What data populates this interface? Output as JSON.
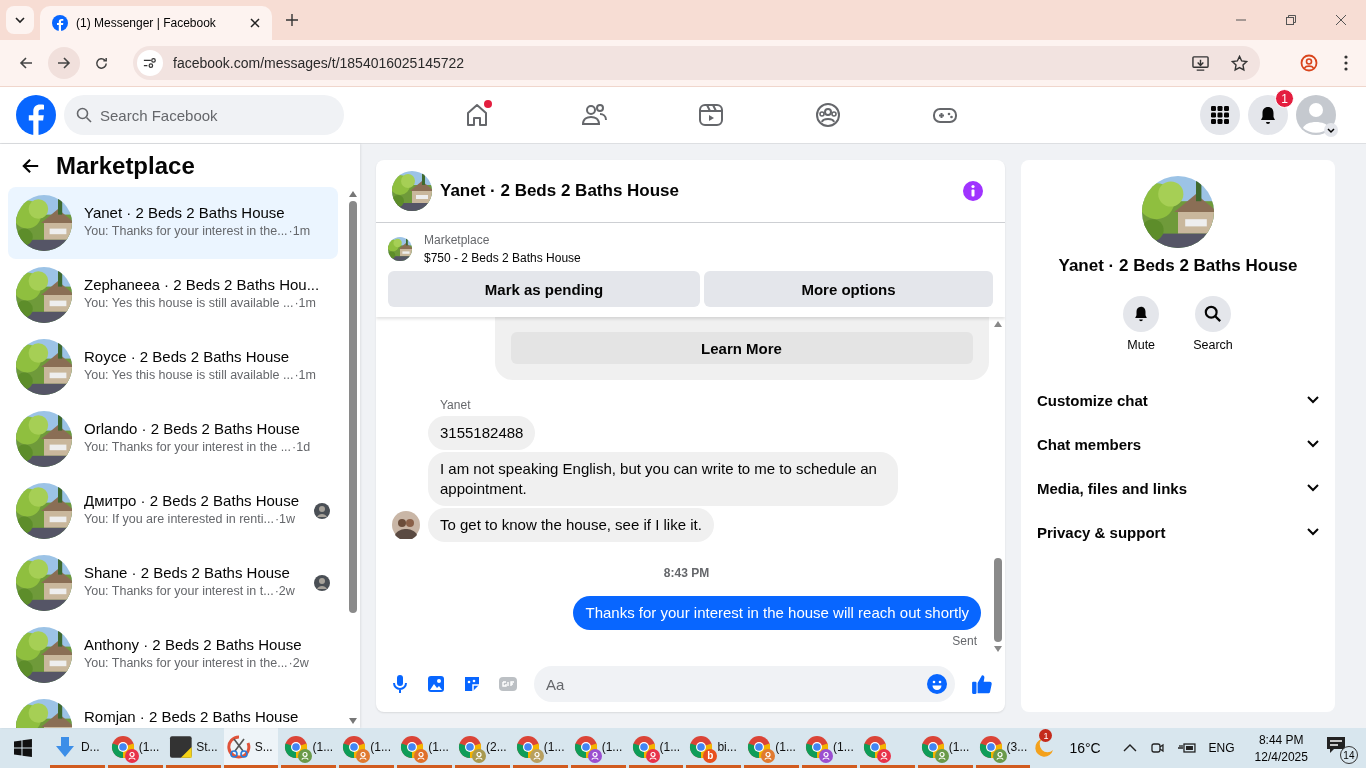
{
  "browser": {
    "tab_title": "(1) Messenger | Facebook",
    "url": "facebook.com/messages/t/1854016025145722"
  },
  "nav": {
    "search_placeholder": "Search Facebook",
    "items": [
      {
        "kind": "home",
        "dot": true
      },
      {
        "kind": "friends",
        "dot": false
      },
      {
        "kind": "video",
        "dot": false
      },
      {
        "kind": "groups",
        "dot": false
      },
      {
        "kind": "gaming",
        "dot": false
      }
    ],
    "notification_count": "1"
  },
  "sidebar": {
    "title": "Marketplace",
    "conversations": [
      {
        "name": "Yanet · 2 Beds 2 Baths House",
        "preview": "You: Thanks for your interest in the...",
        "time": "·1m",
        "selected": true,
        "seen": false
      },
      {
        "name": "Zephaneea · 2 Beds 2 Baths Hou...",
        "preview": "You: Yes this house is still available ...",
        "time": "·1m",
        "selected": false,
        "seen": false
      },
      {
        "name": "Royce · 2 Beds 2 Baths House",
        "preview": "You: Yes this house is still available ...",
        "time": "·1m",
        "selected": false,
        "seen": false
      },
      {
        "name": "Orlando · 2 Beds 2 Baths House",
        "preview": "You: Thanks for your interest in the ...",
        "time": "·1d",
        "selected": false,
        "seen": false
      },
      {
        "name": "Дмитро · 2 Beds 2 Baths House",
        "preview": "You: If you are interested in renti...",
        "time": "·1w",
        "selected": false,
        "seen": true
      },
      {
        "name": "Shane · 2 Beds 2 Baths House",
        "preview": "You: Thanks for your interest in t...",
        "time": "·2w",
        "selected": false,
        "seen": true
      },
      {
        "name": "Anthony · 2 Beds 2 Baths House",
        "preview": "You: Thanks for your interest in the...",
        "time": "·2w",
        "selected": false,
        "seen": false
      },
      {
        "name": "Romjan · 2 Beds 2 Baths House",
        "selected": false,
        "seen": false
      }
    ]
  },
  "chat": {
    "title": "Yanet · 2 Beds 2 Baths House",
    "listing": {
      "label": "Marketplace",
      "title": "$750 - 2 Beds 2 Baths House"
    },
    "actions": [
      "Mark as pending",
      "More options"
    ],
    "card_button": "Learn More",
    "sender": "Yanet",
    "messages": [
      {
        "kind": "received",
        "text": "3155182488",
        "avatar": false
      },
      {
        "kind": "received",
        "text": "I am not speaking English, but you can write to me to schedule an appointment.",
        "avatar": false
      },
      {
        "kind": "received",
        "text": "To get to know the house, see if I like it.",
        "avatar": true
      },
      {
        "kind": "time",
        "text": "8:43 PM"
      },
      {
        "kind": "sent",
        "text": "Thanks for your interest in the house will reach out shortly"
      }
    ],
    "status": "Sent",
    "composer_placeholder": "Aa"
  },
  "details": {
    "name": "Yanet · 2 Beds 2 Baths House",
    "actions": [
      {
        "kind": "mute",
        "label": "Mute"
      },
      {
        "kind": "search",
        "label": "Search"
      }
    ],
    "sections": [
      {
        "label": "Customize chat",
        "expanded": false
      },
      {
        "label": "Chat members",
        "expanded": false
      },
      {
        "label": "Media, files and links",
        "expanded": false
      },
      {
        "label": "Privacy & support",
        "expanded": false
      }
    ]
  },
  "taskbar": {
    "items": [
      {
        "kind": "download",
        "label": "D...",
        "selected": false
      },
      {
        "kind": "chrome",
        "label": "(1...",
        "color": "#e8334a",
        "selected": false
      },
      {
        "kind": "sticky",
        "label": "St...",
        "selected": false
      },
      {
        "kind": "snip",
        "label": "S...",
        "selected": true
      },
      {
        "kind": "chrome",
        "label": "(1...",
        "color": "#6a9a4a",
        "selected": false
      },
      {
        "kind": "chrome",
        "label": "(1...",
        "color": "#e07a30",
        "selected": false
      },
      {
        "kind": "chrome",
        "label": "(1...",
        "color": "#e0702a",
        "selected": false
      },
      {
        "kind": "chrome",
        "label": "(2...",
        "color": "#a89a50",
        "selected": false
      },
      {
        "kind": "chrome",
        "label": "(1...",
        "color": "#b8a060",
        "selected": false
      },
      {
        "kind": "chrome",
        "label": "(1...",
        "color": "#9b4fd0",
        "selected": false
      },
      {
        "kind": "chrome",
        "label": "(1...",
        "color": "#e8334a",
        "selected": false
      },
      {
        "kind": "chrome",
        "label": "bi...",
        "color": "#e8501e",
        "badge_letter": "b",
        "selected": false
      },
      {
        "kind": "chrome",
        "label": "(1...",
        "color": "#e07a30",
        "selected": false
      },
      {
        "kind": "chrome",
        "label": "(1...",
        "color": "#9b4fd0",
        "selected": false
      },
      {
        "kind": "chrome",
        "color": "#e8334a",
        "selected": false
      },
      {
        "kind": "chrome",
        "label": "(1...",
        "color": "#6a9a4a",
        "selected": false
      },
      {
        "kind": "chrome",
        "label": "(3...",
        "color": "#6a9a4a",
        "selected": false
      }
    ],
    "weather": {
      "badge": "1",
      "temp": "16°C"
    },
    "language": "ENG",
    "time": "8:44 PM",
    "date": "12/4/2025",
    "notifications": "14"
  }
}
